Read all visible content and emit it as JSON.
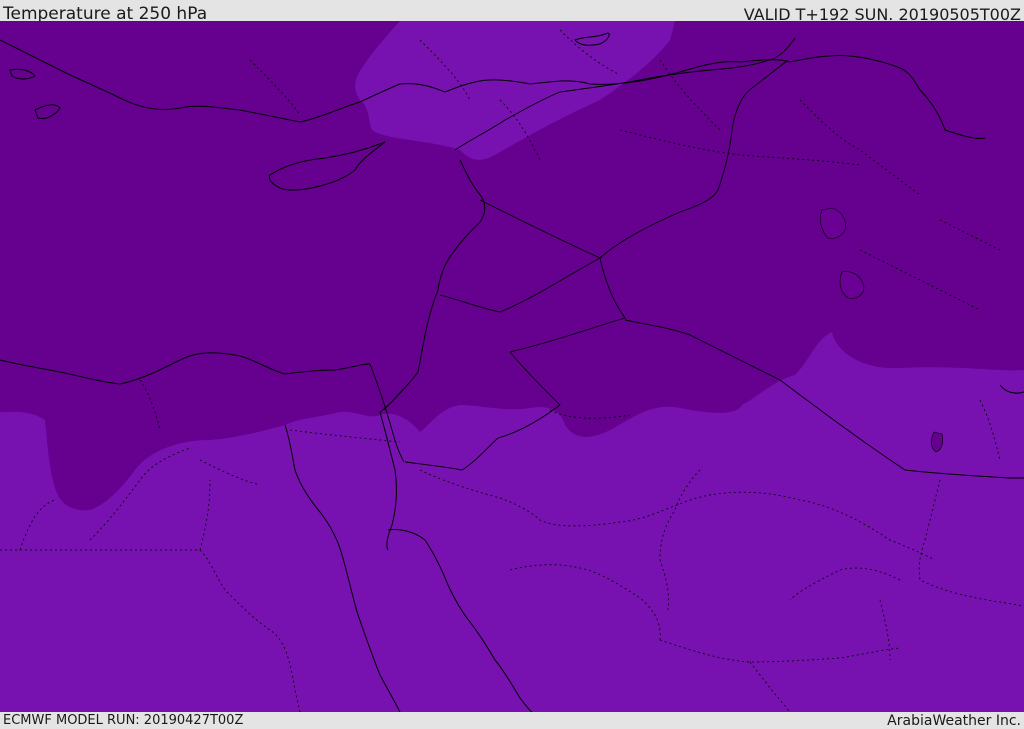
{
  "header": {
    "title": "Temperature at 250 hPa",
    "valid": "VALID T+192 SUN. 20190505T00Z"
  },
  "footer": {
    "model_run": "ECMWF MODEL RUN: 20190427T00Z",
    "brand": "ArabiaWeather Inc."
  },
  "colors": {
    "cold": "#65008f",
    "mild": "#7712b0",
    "lake": "#6a0094",
    "border": "#000000"
  }
}
